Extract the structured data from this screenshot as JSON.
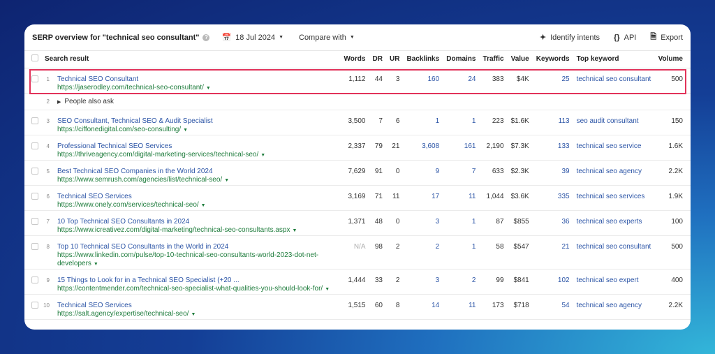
{
  "header": {
    "title": "SERP overview for \"technical seo consultant\"",
    "help_icon": "question-icon",
    "date_label": "18 Jul 2024",
    "compare_label": "Compare with",
    "identify_label": "Identify intents",
    "api_label": "API",
    "export_label": "Export"
  },
  "columns": {
    "search_result": "Search result",
    "words": "Words",
    "dr": "DR",
    "ur": "UR",
    "backlinks": "Backlinks",
    "domains": "Domains",
    "traffic": "Traffic",
    "value": "Value",
    "keywords": "Keywords",
    "top_keyword": "Top keyword",
    "volume": "Volume"
  },
  "people_also_ask": {
    "position": "2",
    "label": "People also ask"
  },
  "rows": [
    {
      "pos": "1",
      "title": "Technical SEO Consultant",
      "url": "https://jaserodley.com/technical-seo-consultant/",
      "words": "1,112",
      "dr": "44",
      "ur": "3",
      "backlinks": "160",
      "domains": "24",
      "traffic": "383",
      "value": "$4K",
      "keywords": "25",
      "top_keyword": "technical seo consultant",
      "volume": "500"
    },
    {
      "pos": "3",
      "title": "SEO Consultant, Technical SEO & Audit Specialist",
      "url": "https://ciffonedigital.com/seo-consulting/",
      "words": "3,500",
      "dr": "7",
      "ur": "6",
      "backlinks": "1",
      "domains": "1",
      "traffic": "223",
      "value": "$1.6K",
      "keywords": "113",
      "top_keyword": "seo audit consultant",
      "volume": "150"
    },
    {
      "pos": "4",
      "title": "Professional Technical SEO Services",
      "url": "https://thriveagency.com/digital-marketing-services/technical-seo/",
      "words": "2,337",
      "dr": "79",
      "ur": "21",
      "backlinks": "3,608",
      "domains": "161",
      "traffic": "2,190",
      "value": "$7.3K",
      "keywords": "133",
      "top_keyword": "technical seo service",
      "volume": "1.6K"
    },
    {
      "pos": "5",
      "title": "Best Technical SEO Companies in the World 2024",
      "url": "https://www.semrush.com/agencies/list/technical-seo/",
      "words": "7,629",
      "dr": "91",
      "ur": "0",
      "backlinks": "9",
      "domains": "7",
      "traffic": "633",
      "value": "$2.3K",
      "keywords": "39",
      "top_keyword": "technical seo agency",
      "volume": "2.2K"
    },
    {
      "pos": "6",
      "title": "Technical SEO Services",
      "url": "https://www.onely.com/services/technical-seo/",
      "words": "3,169",
      "dr": "71",
      "ur": "11",
      "backlinks": "17",
      "domains": "11",
      "traffic": "1,044",
      "value": "$3.6K",
      "keywords": "335",
      "top_keyword": "technical seo services",
      "volume": "1.9K"
    },
    {
      "pos": "7",
      "title": "10 Top Technical SEO Consultants in 2024",
      "url": "https://www.icreativez.com/digital-marketing/technical-seo-consultants.aspx",
      "words": "1,371",
      "dr": "48",
      "ur": "0",
      "backlinks": "3",
      "domains": "1",
      "traffic": "87",
      "value": "$855",
      "keywords": "36",
      "top_keyword": "technical seo experts",
      "volume": "100"
    },
    {
      "pos": "8",
      "title": "Top 10 Technical SEO Consultants in the World in 2024",
      "url": "https://www.linkedin.com/pulse/top-10-technical-seo-consultants-world-2023-dot-net-developers",
      "words": "N/A",
      "dr": "98",
      "ur": "2",
      "backlinks": "2",
      "domains": "1",
      "traffic": "58",
      "value": "$547",
      "keywords": "21",
      "top_keyword": "technical seo consultant",
      "volume": "500"
    },
    {
      "pos": "9",
      "title": "15 Things to Look for in a Technical SEO Specialist (+20 ...",
      "url": "https://contentmender.com/technical-seo-specialist-what-qualities-you-should-look-for/",
      "words": "1,444",
      "dr": "33",
      "ur": "2",
      "backlinks": "3",
      "domains": "2",
      "traffic": "99",
      "value": "$841",
      "keywords": "102",
      "top_keyword": "technical seo expert",
      "volume": "400"
    },
    {
      "pos": "10",
      "title": "Technical SEO Services",
      "url": "https://salt.agency/expertise/technical-seo/",
      "words": "1,515",
      "dr": "60",
      "ur": "8",
      "backlinks": "14",
      "domains": "11",
      "traffic": "173",
      "value": "$718",
      "keywords": "54",
      "top_keyword": "technical seo agency",
      "volume": "2.2K"
    }
  ],
  "colors": {
    "link": "#2b54a6",
    "url": "#1e7c3c",
    "highlight": "#e2335a"
  }
}
